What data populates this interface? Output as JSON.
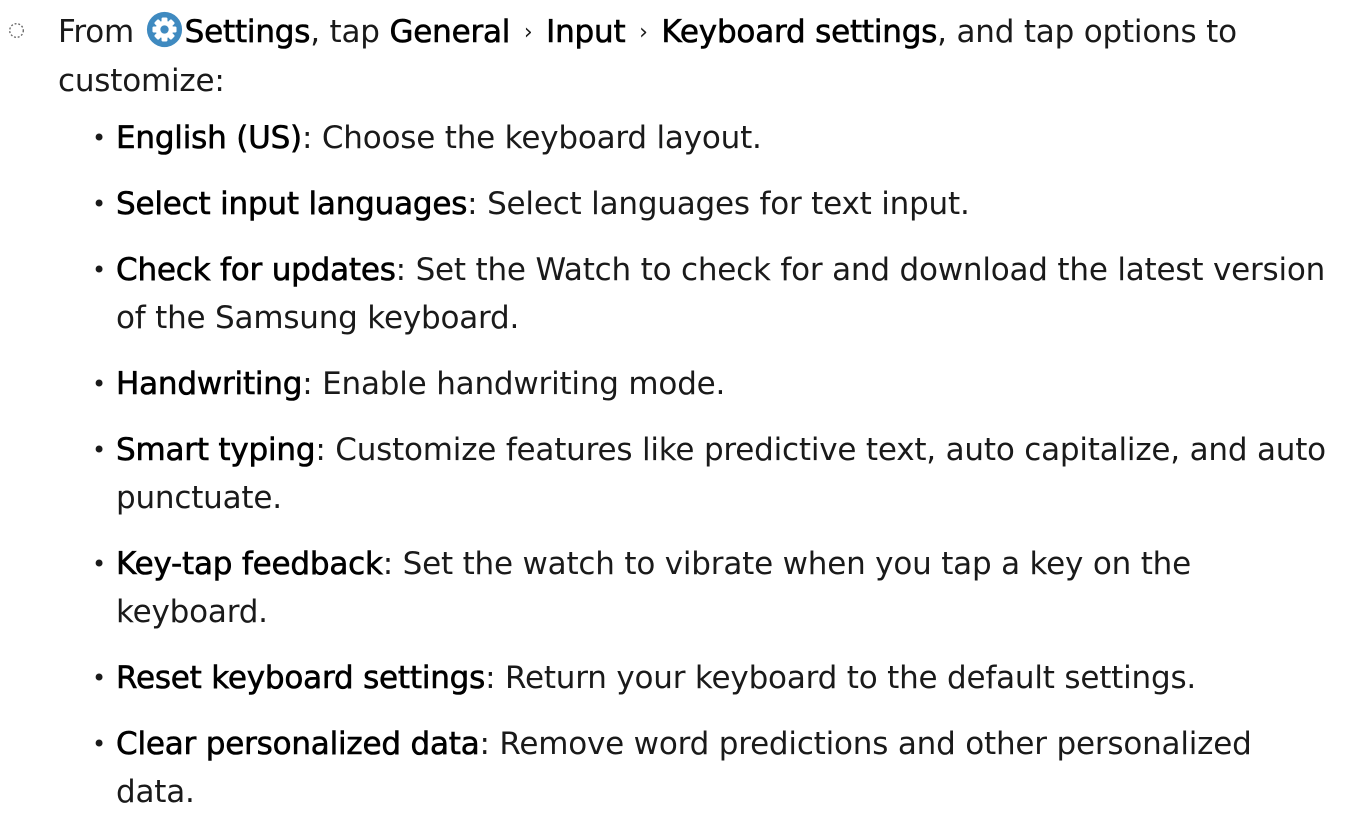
{
  "intro": {
    "prefix": "From",
    "settings": "Settings",
    "mid": ", tap",
    "general": "General",
    "input": "Input",
    "keyboard_settings": "Keyboard settings",
    "suffix": ", and tap options to customize:",
    "separator": "›"
  },
  "options": [
    {
      "name": "English (US)",
      "desc": ": Choose the keyboard layout."
    },
    {
      "name": "Select input languages",
      "desc": ": Select languages for text input."
    },
    {
      "name": "Check for updates",
      "desc": ": Set the Watch to check for and download the latest version of the Samsung keyboard."
    },
    {
      "name": "Handwriting",
      "desc": ": Enable handwriting mode."
    },
    {
      "name": "Smart typing",
      "desc": ": Customize features like predictive text, auto capitalize, and auto punctuate."
    },
    {
      "name": "Key-tap feedback",
      "desc": ": Set the watch to vibrate when you tap a key on the keyboard."
    },
    {
      "name": "Reset keyboard settings",
      "desc": ": Return your keyboard to the default settings."
    },
    {
      "name": "Clear personalized data",
      "desc": ": Remove word predictions and other personalized data."
    }
  ],
  "icons": {
    "step_marker": "step-circle-icon",
    "settings": "settings-gear-icon"
  },
  "colors": {
    "settings_icon_bg": "#3f8ac0",
    "text": "#1a1a1a"
  }
}
